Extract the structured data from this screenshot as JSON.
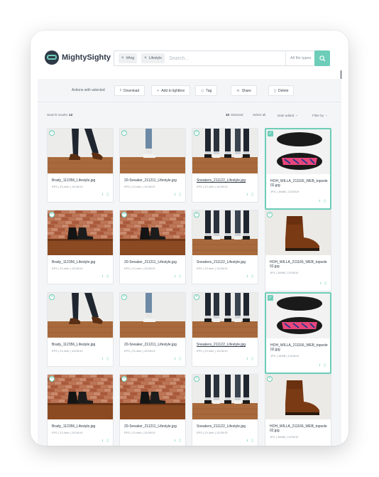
{
  "brand": {
    "name": "MightySighty"
  },
  "search": {
    "tags": [
      "#Ang",
      "Lifestyle"
    ],
    "placeholder": "Search...",
    "file_type": "All file types"
  },
  "actions": {
    "label": "Actions with selected",
    "buttons": [
      "Download",
      "Add to lightbox",
      "Tag",
      "Share",
      "Delete"
    ]
  },
  "results": {
    "label": "Search results:",
    "count": "12",
    "selected_count": "10",
    "selected_label": "Selected",
    "select_all": "Select all",
    "sort": "Date added",
    "filter": "Filter by"
  },
  "colors": {
    "accent": "#6dcdb8",
    "dark": "#2f3a48"
  },
  "cards": [
    {
      "name": "Brady_112356_Lifestyle.jpg",
      "info": "EPS | 23.4mb | 12/06/19",
      "img": "legs-walk",
      "selected": false
    },
    {
      "name": "20-Sneaker_211211_Lifestyle.jpg",
      "info": "EPS | 23.4mb | 12/06/19",
      "img": "legs-sneaker",
      "selected": false
    },
    {
      "name": "Sneakers_211122_Lifestyle.jpg",
      "info": "EPS | 23.4mb | 12/06/19",
      "img": "legs-group",
      "selected": false,
      "underline": true
    },
    {
      "name": "HOH_WILLA_211166_WEB_topsole 02.jpg",
      "info": "JPG | 34MB | 12/06/19",
      "img": "sandal",
      "selected": true
    },
    {
      "name": "Brady_112356_Lifestyle.jpg",
      "info": "EPS | 23.4mb | 12/06/19",
      "img": "boots-brick",
      "selected": false
    },
    {
      "name": "20-Sneaker_211211_Lifestyle.jpg",
      "info": "EPS | 23.4mb | 12/06/19",
      "img": "boots-brick2",
      "selected": false
    },
    {
      "name": "Sneakers_211122_Lifestyle.jpg",
      "info": "EPS | 23.4mb | 12/06/19",
      "img": "legs-group",
      "selected": false
    },
    {
      "name": "HOH_WILLA_211166_WEB_topsole 02.jpg",
      "info": "JPG | 34MB | 12/06/19",
      "img": "brown-boot",
      "selected": false
    },
    {
      "name": "Brady_112356_Lifestyle.jpg",
      "info": "EPS | 23.4mb | 12/06/19",
      "img": "legs-walk",
      "selected": false
    },
    {
      "name": "20-Sneaker_211211_Lifestyle.jpg",
      "info": "EPS | 23.4mb | 12/06/19",
      "img": "legs-sneaker",
      "selected": false
    },
    {
      "name": "Sneakers_211122_Lifestyle.jpg",
      "info": "EPS | 23.4mb | 12/06/19",
      "img": "legs-group",
      "selected": false,
      "underline": true
    },
    {
      "name": "HOH_WILLA_211166_WEB_topsole 02.jpg",
      "info": "JPG | 34MB | 12/06/19",
      "img": "sandal",
      "selected": true
    },
    {
      "name": "Brady_112356_Lifestyle.jpg",
      "info": "EPS | 23.4mb | 12/06/19",
      "img": "boots-brick",
      "selected": false
    },
    {
      "name": "20-Sneaker_211211_Lifestyle.jpg",
      "info": "EPS | 23.4mb | 12/06/19",
      "img": "boots-brick2",
      "selected": false
    },
    {
      "name": "Sneakers_211122_Lifestyle.jpg",
      "info": "EPS | 23.4mb | 12/06/19",
      "img": "legs-group",
      "selected": false
    },
    {
      "name": "HOH_WILLA_211166_WEB_topsole 02.jpg",
      "info": "JPG | 34MB | 12/06/19",
      "img": "brown-boot",
      "selected": false
    }
  ]
}
